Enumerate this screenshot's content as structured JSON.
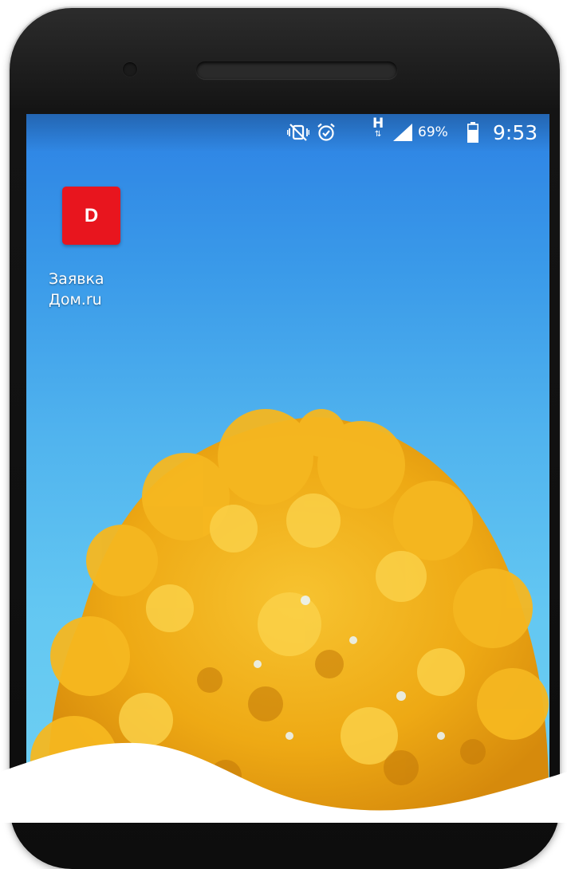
{
  "status_bar": {
    "icons": [
      "vibrate-off-icon",
      "alarm-icon",
      "network-h-icon",
      "signal-icon",
      "battery-icon"
    ],
    "network_type": "H",
    "battery_percent": "69%",
    "battery_level": 0.69,
    "time": "9:53"
  },
  "home_screen": {
    "apps": [
      {
        "icon_letter": "D",
        "icon_color": "#e8151e",
        "label_line1": "Заявка",
        "label_line2": "Дом.ru"
      }
    ]
  },
  "wallpaper": {
    "sky_colors": [
      "#2d82e4",
      "#6fd0f3"
    ],
    "foliage_color": "#f2b21c"
  }
}
